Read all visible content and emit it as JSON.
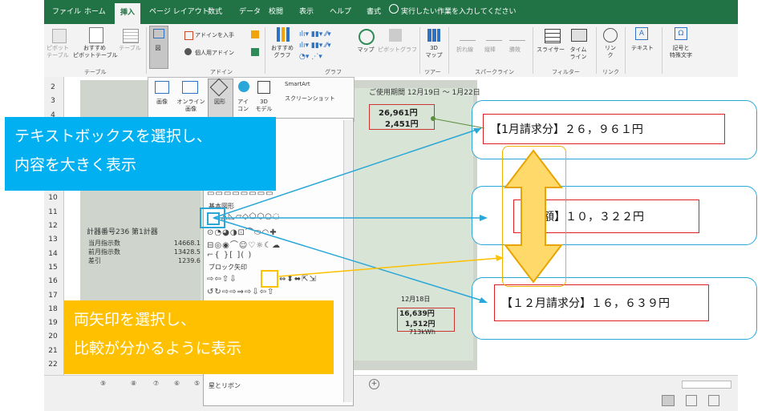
{
  "tabs": [
    "ファイル",
    "ホーム",
    "挿入",
    "ページ レイアウト",
    "数式",
    "データ",
    "校閲",
    "表示",
    "ヘルプ",
    "書式"
  ],
  "active_tab": "挿入",
  "tell_me": "実行したい作業を入力してください",
  "ribbon": {
    "pivot": "ピボット\nテーブル",
    "recommended_pivot": "おすすめ\nピボットテーブル",
    "table": "テーブル",
    "group_table": "テーブル",
    "figure": "図",
    "get_addins": "アドインを入手",
    "my_addins": "個人用アドイン",
    "group_addins": "アドイン",
    "recommended_charts": "おすすめ\nグラフ",
    "maps": "マップ",
    "pivotchart": "ピボットグラフ",
    "group_charts": "グラフ",
    "map3d": "3D\nマップ",
    "group_tours": "ツアー",
    "line": "折れ線",
    "column": "縦棒",
    "winloss": "勝敗",
    "group_sparklines": "スパークライン",
    "slicer": "スライサー",
    "timeline": "タイム\nライン",
    "group_filters": "フィルター",
    "link": "リン\nク",
    "group_links": "リンク",
    "text": "テキスト",
    "symbols": "記号と\n特殊文字"
  },
  "gallery": {
    "image": "画像",
    "online_image": "オンライン\n画像",
    "shapes": "図形",
    "icons": "アイ\nコン",
    "models3d": "3D\nモデル",
    "smartart": "SmartArt",
    "screenshot": "スクリーンショット"
  },
  "shapes_panel": {
    "basic": "基本図形",
    "block_arrows": "ブロック矢印",
    "stars": "星とリボン"
  },
  "rows": [
    "2",
    "3",
    "4",
    "5",
    "6",
    "7",
    "8",
    "9",
    "10",
    "11",
    "12",
    "13",
    "14",
    "15",
    "16",
    "17",
    "18",
    "19",
    "20",
    "21",
    "22"
  ],
  "sheet_tabs": [
    "⑨",
    "⑧",
    "⑦",
    "⑥",
    "⑤"
  ],
  "doc": {
    "date_label": "ご使用期間",
    "dates": "12月19日 ～ 1月22日",
    "amount1": "26,961円",
    "amount2": "2,451円",
    "meter_no": "計器番号236 第1計器",
    "this_month": "当月指示数",
    "this_month_val": "14668.1",
    "prev_month": "前月指示数",
    "prev_month_val": "13428.5",
    "diff_label": "差引",
    "diff_val": "1239.6",
    "amount3": "16,639円",
    "amount4": "1,512円",
    "kwh": "713kWh",
    "period2": "12月18日"
  },
  "callouts": {
    "jan": "【1月請求分】２６，９６１円",
    "diff": "【差額】１０，３２２円",
    "dec": "【１２月請求分】１６，６３９円",
    "blue_banner_l1": "テキストボックスを選択し、",
    "blue_banner_l2": "内容を大きく表示",
    "yellow_banner_l1": "両矢印を選択し、",
    "yellow_banner_l2": "比較が分かるように表示"
  },
  "colors": {
    "excel_green": "#217346",
    "banner_blue": "#00b0f0",
    "banner_yellow": "#ffc000",
    "callout_red": "#e02020",
    "callout_border": "#2aa7d8",
    "arrow_fill": "#ffd96a"
  }
}
